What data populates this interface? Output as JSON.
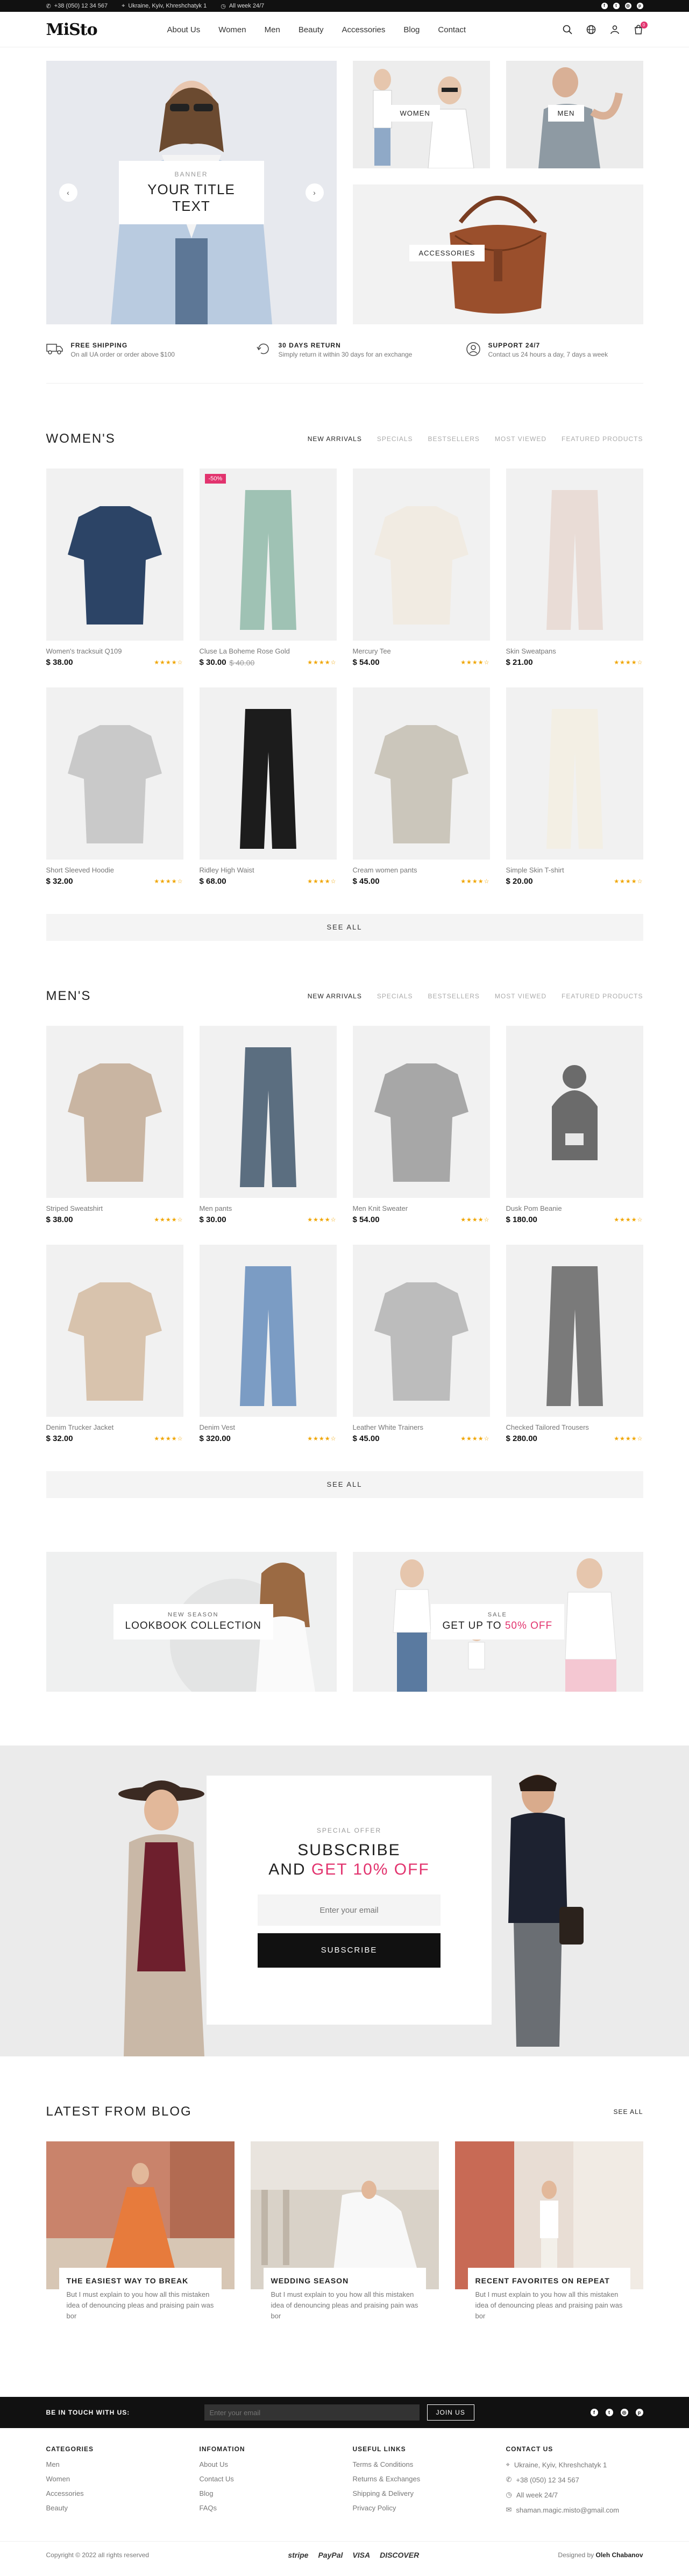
{
  "topbar": {
    "phone": "+38 (050) 12 34 567",
    "address": "Ukraine, Kyiv, Khreshchatyk 1",
    "hours": "All week 24/7",
    "social_icons": [
      "facebook-icon",
      "twitter-icon",
      "instagram-icon",
      "pinterest-icon"
    ]
  },
  "header": {
    "logo": "MiSto",
    "nav": [
      "About Us",
      "Women",
      "Men",
      "Beauty",
      "Accessories",
      "Blog",
      "Contact"
    ],
    "cart_count": "0"
  },
  "hero": {
    "banner_sub": "BANNER",
    "banner_title": "YOUR TITLE TEXT",
    "women": "WOMEN",
    "men": "MEN",
    "accessories": "ACCESSORIES"
  },
  "features": [
    {
      "icon": "truck-icon",
      "title": "FREE SHIPPING",
      "text": "On all UA order or order above $100"
    },
    {
      "icon": "return-icon",
      "title": "30 DAYS RETURN",
      "text": "Simply return it within 30 days for an exchange"
    },
    {
      "icon": "support-icon",
      "title": "SUPPORT 24/7",
      "text": "Contact us 24 hours a day, 7 days a week"
    }
  ],
  "tabs": [
    "NEW ARRIVALS",
    "SPECIALS",
    "BESTSELLERS",
    "MOST VIEWED",
    "FEATURED PRODUCTS"
  ],
  "women": {
    "title": "WOMEN'S",
    "see_all": "SEE ALL",
    "products": [
      {
        "name": "Women's tracksuit Q109",
        "price": "$ 38.00",
        "old": "",
        "rating": 4
      },
      {
        "name": "Cluse La Boheme Rose Gold",
        "price": "$ 30.00",
        "old": "$ 40.00",
        "badge": "-50%",
        "rating": 4
      },
      {
        "name": "Mercury Tee",
        "price": "$ 54.00",
        "old": "",
        "rating": 4
      },
      {
        "name": "Skin Sweatpans",
        "price": "$ 21.00",
        "old": "",
        "rating": 4
      },
      {
        "name": "Short Sleeved Hoodie",
        "price": "$ 32.00",
        "old": "",
        "rating": 4
      },
      {
        "name": "Ridley High Waist",
        "price": "$ 68.00",
        "old": "",
        "rating": 4
      },
      {
        "name": "Cream women pants",
        "price": "$ 45.00",
        "old": "",
        "rating": 4
      },
      {
        "name": "Simple Skin T-shirt",
        "price": "$ 20.00",
        "old": "",
        "rating": 4
      }
    ]
  },
  "men": {
    "title": "MEN'S",
    "see_all": "SEE ALL",
    "products": [
      {
        "name": "Striped Sweatshirt",
        "price": "$ 38.00",
        "old": "",
        "rating": 4
      },
      {
        "name": "Men pants",
        "price": "$ 30.00",
        "old": "",
        "rating": 4
      },
      {
        "name": "Men Knit Sweater",
        "price": "$ 54.00",
        "old": "",
        "rating": 4
      },
      {
        "name": "Dusk Pom Beanie",
        "price": "$ 180.00",
        "old": "",
        "rating": 4
      },
      {
        "name": "Denim Trucker Jacket",
        "price": "$ 32.00",
        "old": "",
        "rating": 4
      },
      {
        "name": "Denim Vest",
        "price": "$ 320.00",
        "old": "",
        "rating": 4
      },
      {
        "name": "Leather White Trainers",
        "price": "$ 45.00",
        "old": "",
        "rating": 4
      },
      {
        "name": "Checked Tailored Trousers",
        "price": "$ 280.00",
        "old": "",
        "rating": 4
      }
    ]
  },
  "promos": {
    "left_sub": "NEW SEASON",
    "left_title": "LOOKBOOK COLLECTION",
    "right_sub": "SALE",
    "right_title_a": "GET UP TO ",
    "right_title_b": "50% OFF"
  },
  "subscribe": {
    "label": "SPECIAL OFFER",
    "line1": "SUBSCRIBE",
    "line2a": "AND ",
    "line2b": "GET 10% OFF",
    "placeholder": "Enter your email",
    "button": "SUBSCRIBE"
  },
  "blog": {
    "title": "LATEST FROM BLOG",
    "see_all": "SEE ALL",
    "posts": [
      {
        "title": "THE EASIEST WAY TO BREAK",
        "text": "But I must explain to you how all this mistaken idea of denouncing pleas and praising pain was bor"
      },
      {
        "title": "WEDDING SEASON",
        "text": "But I must explain to you how all this mistaken idea of denouncing pleas and praising pain was bor"
      },
      {
        "title": "RECENT FAVORITES ON REPEAT",
        "text": "But I must explain to you how all this mistaken idea of denouncing pleas and praising pain was bor"
      }
    ]
  },
  "newsbar": {
    "label": "BE IN TOUCH WITH US:",
    "placeholder": "Enter your email",
    "button": "JOIN US"
  },
  "footer": {
    "categories": {
      "title": "CATEGORIES",
      "links": [
        "Men",
        "Women",
        "Accessories",
        "Beauty"
      ]
    },
    "information": {
      "title": "INFOMATION",
      "links": [
        "About Us",
        "Contact Us",
        "Blog",
        "FAQs"
      ]
    },
    "useful": {
      "title": "USEFUL LINKS",
      "links": [
        "Terms & Conditions",
        "Returns & Exchanges",
        "Shipping & Delivery",
        "Privacy Policy"
      ]
    },
    "contact": {
      "title": "CONTACT US",
      "links": [
        "Ukraine, Kyiv, Khreshchatyk 1",
        "+38 (050) 12 34 567",
        "All week 24/7",
        "shaman.magic.misto@gmail.com"
      ]
    },
    "copyright": "Copyright © 2022 all rights reserved",
    "payments": [
      "stripe",
      "PayPal",
      "VISA",
      "DISCOVER"
    ],
    "designed_by": "Designed by",
    "designer": "Oleh Chabanov"
  },
  "colors": {
    "accent": "#e2336e",
    "dark": "#111111",
    "star": "#f0a500"
  }
}
